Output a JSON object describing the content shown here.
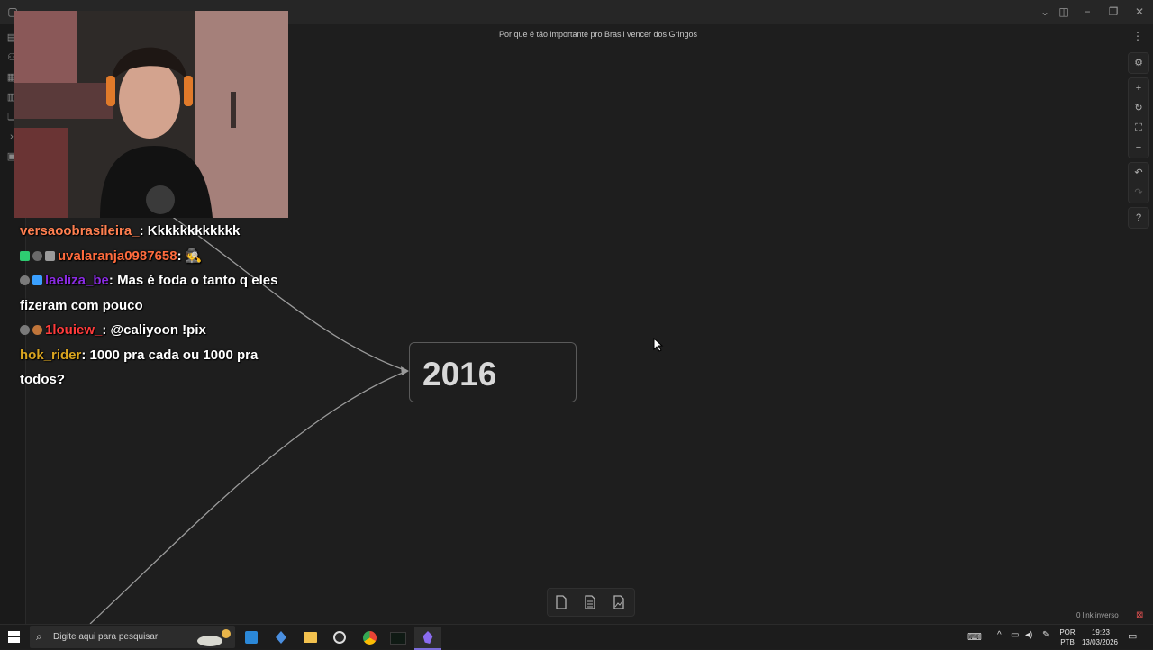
{
  "window": {
    "note_title": "Por que é tão importante pro Brasil vencer dos Gringos"
  },
  "canvas": {
    "node_text": "2016",
    "backlinks_label": "0 link inverso"
  },
  "chat": [
    {
      "user": "versaoobrasileira_",
      "user_color": "#ff7f50",
      "message": "Kkkkkkkkkkkk",
      "badges": []
    },
    {
      "user": "uvalaranja0987658",
      "user_color": "#ff6b3d",
      "message": "🕵",
      "badges": [
        "#2ecc71",
        "#6a6a6a",
        "#9a9a9a"
      ]
    },
    {
      "user": "laeliza_be",
      "user_color": "#8a2be2",
      "message": "Mas é foda o tanto q eles fizeram com pouco",
      "badges": [
        "#7a7a7a",
        "#3aa0ff"
      ]
    },
    {
      "user": "1louiew_",
      "user_color": "#ff3b3b",
      "message": "@caliyoon !pix",
      "badges": [
        "#7a7a7a",
        "#c0753a"
      ]
    },
    {
      "user": "hok_rider",
      "user_color": "#daa520",
      "message": "1000 pra cada ou 1000 pra todos?",
      "badges": []
    }
  ],
  "taskbar": {
    "search_placeholder": "Digite aqui para pesquisar",
    "lang_top": "POR",
    "lang_bottom": "PTB",
    "time": "19:23",
    "date": "13/03/2026"
  },
  "colors": {
    "background": "#1e1e1e",
    "taskbar": "#1c1c1c",
    "accent": "#7b6cd9"
  }
}
